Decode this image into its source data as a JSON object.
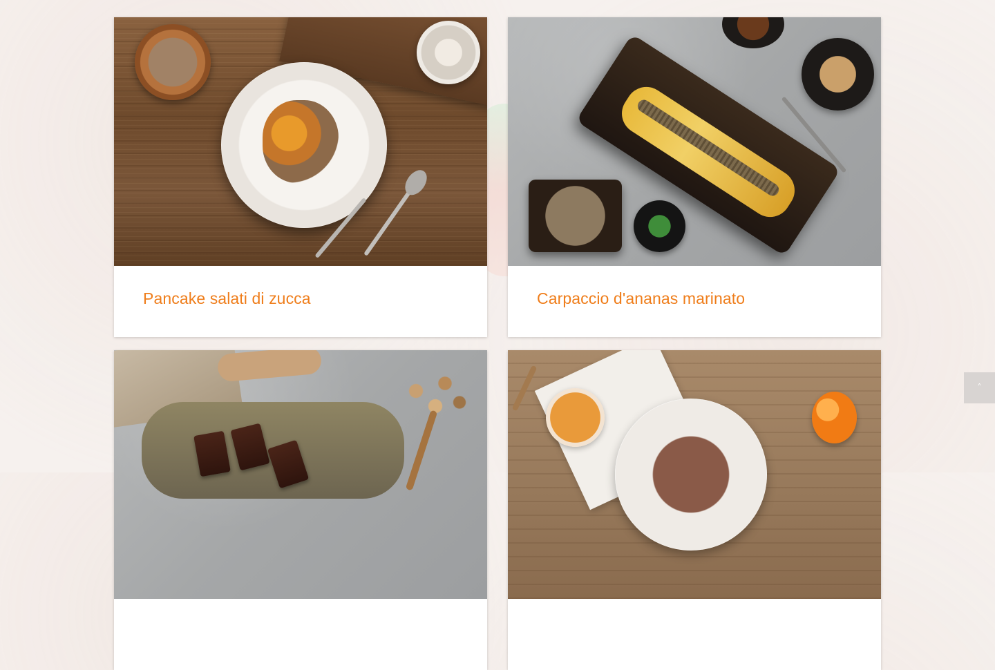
{
  "recipes": [
    {
      "title": "Pancake salati di zucca"
    },
    {
      "title": "Carpaccio d'ananas marinato"
    },
    {
      "title": ""
    },
    {
      "title": ""
    }
  ],
  "back_to_top": {
    "icon": "chevron-up-icon",
    "glyph": "˄"
  },
  "colors": {
    "accent": "#ef7d1a",
    "background": "#f6f1ee"
  }
}
